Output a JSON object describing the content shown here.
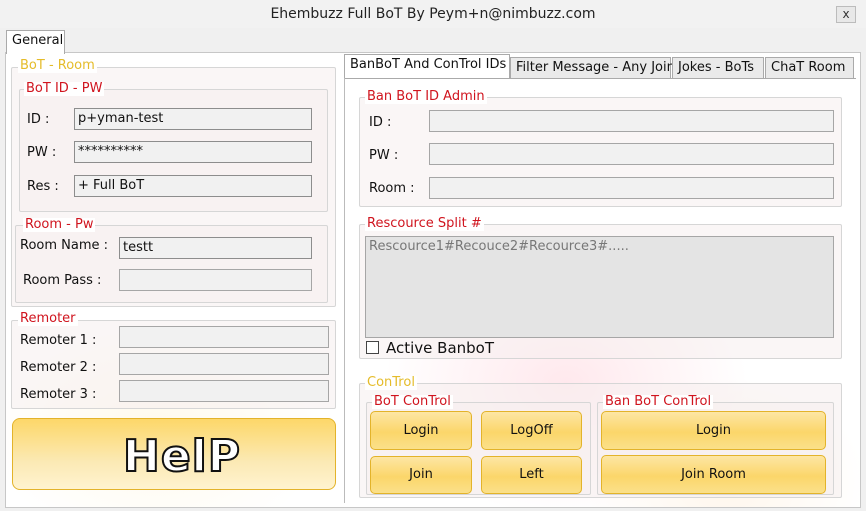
{
  "window": {
    "title": "Ehembuzz Full BoT By Peym+n@nimbuzz.com",
    "close_glyph": "x"
  },
  "main_tabs": [
    {
      "label": "General"
    }
  ],
  "bot_room": {
    "legend": "BoT - Room",
    "id_pw": {
      "legend": "BoT  ID - PW",
      "id_label": "ID :",
      "id_value": "p+yman-test",
      "pw_label": "PW :",
      "pw_value": "**********",
      "res_label": "Res :",
      "res_value": "+ Full BoT"
    },
    "room_pw": {
      "legend": "Room - Pw",
      "name_label": "Room Name :",
      "name_value": "testt",
      "pass_label": "Room Pass :",
      "pass_value": ""
    }
  },
  "remoter": {
    "legend": "Remoter",
    "labels": [
      "Remoter 1 :",
      "Remoter 2 :",
      "Remoter 3 :"
    ]
  },
  "help_button": {
    "label": "HelP"
  },
  "sub_tabs": [
    {
      "label": "BanBoT And ConTrol IDs"
    },
    {
      "label": "Filter Message - Any Join"
    },
    {
      "label": "Jokes - BoTs"
    },
    {
      "label": "ChaT Room"
    }
  ],
  "ban_admin": {
    "legend": "Ban BoT ID Admin",
    "id_label": "ID :",
    "pw_label": "PW :",
    "room_label": "Room :"
  },
  "resource_split": {
    "legend": "Rescource Split #",
    "placeholder": "Rescource1#Recouce2#Recource3#.....",
    "active_label": "Active BanboT"
  },
  "control": {
    "legend": "ConTrol",
    "bot_control": {
      "legend": "BoT ConTrol",
      "login": "Login",
      "logoff": "LogOff",
      "join": "Join",
      "left": "Left"
    },
    "ban_bot_control": {
      "legend": "Ban BoT ConTrol",
      "login": "Login",
      "join_room": "Join Room"
    }
  },
  "colors": {
    "legend_yellow": "#e5bc2a",
    "legend_red": "#d0141e",
    "button_yellow": "#fbd66a"
  }
}
